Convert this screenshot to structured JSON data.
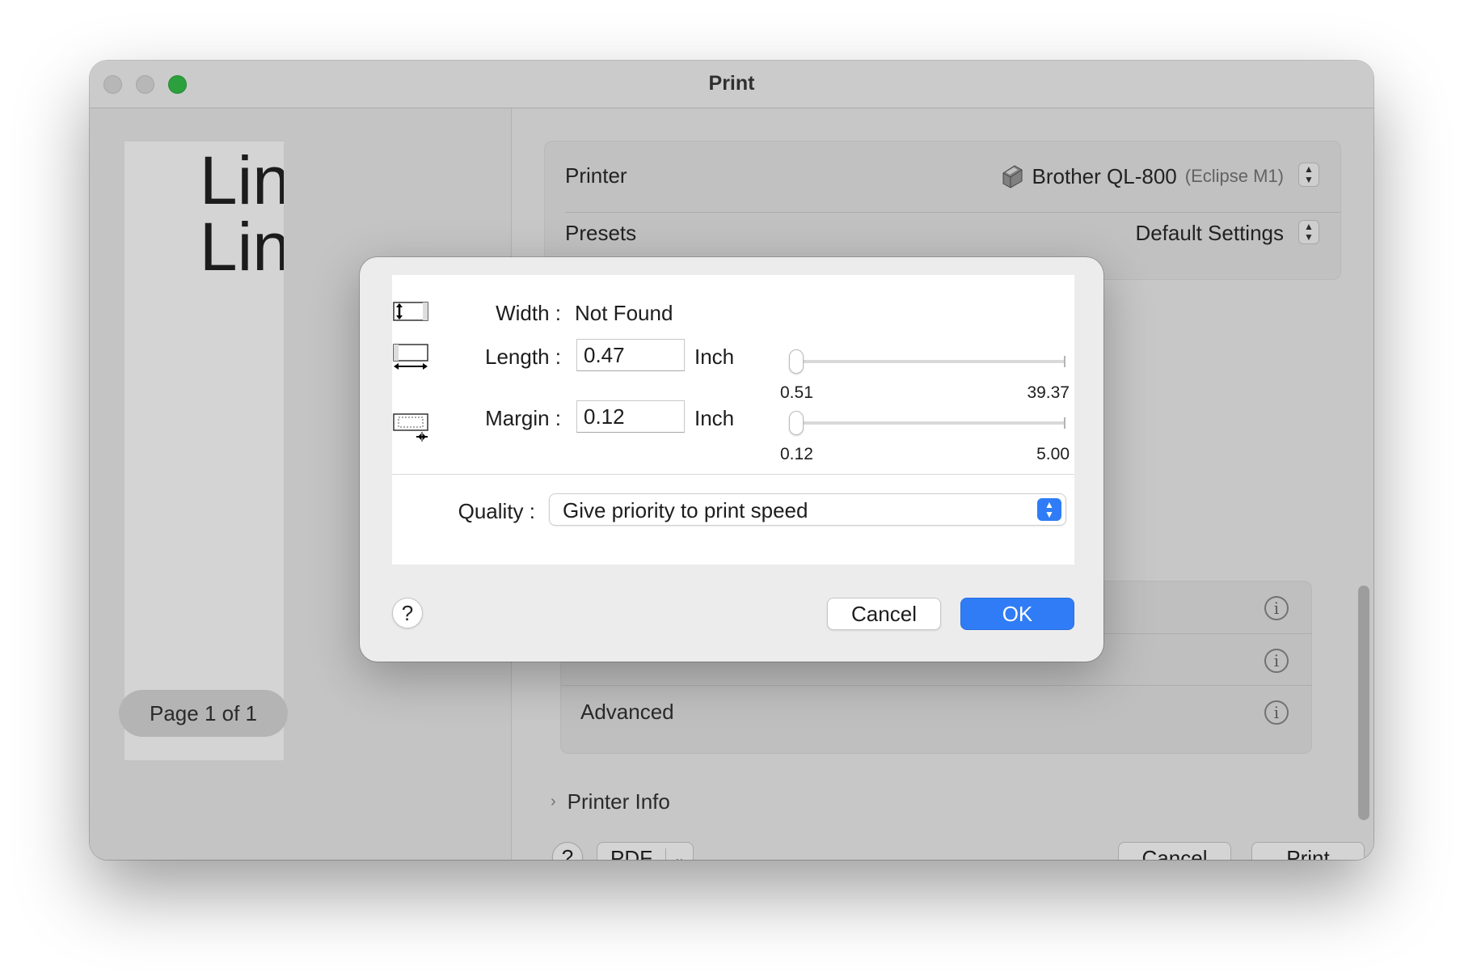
{
  "window": {
    "title": "Print"
  },
  "preview": {
    "lines": [
      "Lin",
      "Lin"
    ],
    "page_indicator": "Page 1 of 1"
  },
  "settings": {
    "printer_label": "Printer",
    "printer_name": "Brother QL-800",
    "printer_location": "(Eclipse M1)",
    "presets_label": "Presets",
    "presets_value": "Default Settings",
    "section_last_label": "Advanced",
    "printer_info_label": "Printer Info",
    "help_label": "?",
    "pdf_label": "PDF",
    "cancel_label": "Cancel",
    "print_label": "Print"
  },
  "sheet": {
    "width_label": "Width :",
    "width_value": "Not Found",
    "length_label": "Length :",
    "length_value": "0.47",
    "length_unit": "Inch",
    "length_min": "0.51",
    "length_max": "39.37",
    "margin_label": "Margin :",
    "margin_value": "0.12",
    "margin_unit": "Inch",
    "margin_min": "0.12",
    "margin_max": "5.00",
    "quality_label": "Quality :",
    "quality_value": "Give priority to print speed",
    "help_label": "?",
    "cancel_label": "Cancel",
    "ok_label": "OK"
  },
  "colors": {
    "accent": "#2f7cf6",
    "zoom_button": "#35c14a"
  },
  "icons": {
    "window_controls": [
      "close-button",
      "minimize-button",
      "zoom-button"
    ],
    "printer": "label-printer-icon",
    "width": "width-icon",
    "length": "length-icon",
    "margin": "margin-icon",
    "info": "info-icon",
    "disclosure": "chevron-right-icon",
    "stepper": "up-down-stepper-icon"
  }
}
